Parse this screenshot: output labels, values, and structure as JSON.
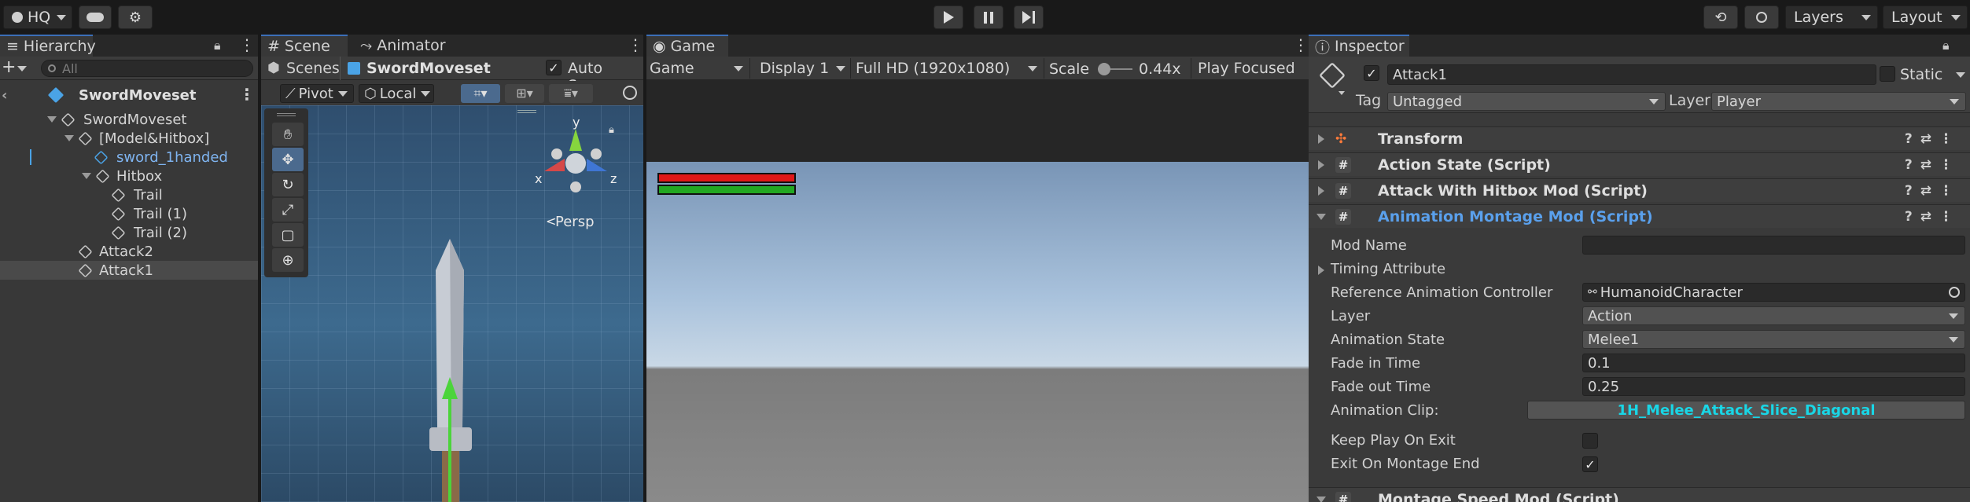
{
  "toolbar": {
    "account": "HQ",
    "layers": "Layers",
    "layout": "Layout"
  },
  "hierarchy": {
    "tab": "Hierarchy",
    "search_placeholder": "All",
    "scene_name": "SwordMoveset",
    "items": [
      {
        "label": "SwordMoveset"
      },
      {
        "label": "[Model&Hitbox]"
      },
      {
        "label": "sword_1handed"
      },
      {
        "label": "Hitbox"
      },
      {
        "label": "Trail"
      },
      {
        "label": "Trail (1)"
      },
      {
        "label": "Trail (2)"
      },
      {
        "label": "Attack2"
      },
      {
        "label": "Attack1"
      }
    ]
  },
  "scene": {
    "tab": "Scene",
    "tab2": "Animator",
    "breadcrumb_root": "Scenes",
    "breadcrumb_current": "SwordMoveset",
    "auto_save": "Auto Save",
    "pivot": "Pivot",
    "local": "Local",
    "gizmo_y": "y",
    "gizmo_x": "x",
    "gizmo_z": "z",
    "persp": "Persp"
  },
  "game": {
    "tab": "Game",
    "mode": "Game",
    "display": "Display 1",
    "resolution": "Full HD (1920x1080)",
    "scale_label": "Scale",
    "scale_value": "0.44x",
    "play_focused": "Play Focused"
  },
  "inspector": {
    "tab": "Inspector",
    "object_name": "Attack1",
    "static_label": "Static",
    "tag_label": "Tag",
    "tag_value": "Untagged",
    "layer_label": "Layer",
    "layer_value": "Player",
    "components": [
      {
        "label": "Transform"
      },
      {
        "label": "Action State (Script)"
      },
      {
        "label": "Attack With Hitbox Mod (Script)"
      },
      {
        "label": "Animation Montage Mod (Script)"
      },
      {
        "label": "Montage Speed Mod (Script)"
      }
    ],
    "props": {
      "mod_name": "Mod Name",
      "timing_attribute": "Timing Attribute",
      "ref_controller": "Reference Animation Controller",
      "ref_controller_value": "HumanoidCharacter",
      "layer": "Layer",
      "layer_value": "Action",
      "anim_state": "Animation State",
      "anim_state_value": "Melee1",
      "fade_in": "Fade in Time",
      "fade_in_value": "0.1",
      "fade_out": "Fade out Time",
      "fade_out_value": "0.25",
      "anim_clip": "Animation Clip:",
      "anim_clip_value": "1H_Melee_Attack_Slice_Diagonal",
      "keep_play": "Keep Play On Exit",
      "exit_on_end": "Exit On Montage End"
    }
  },
  "colors": {
    "accent_blue": "#3c6fb8",
    "health_red": "#e01818",
    "stamina_green": "#22a822",
    "clip_text": "#19d6e6"
  }
}
